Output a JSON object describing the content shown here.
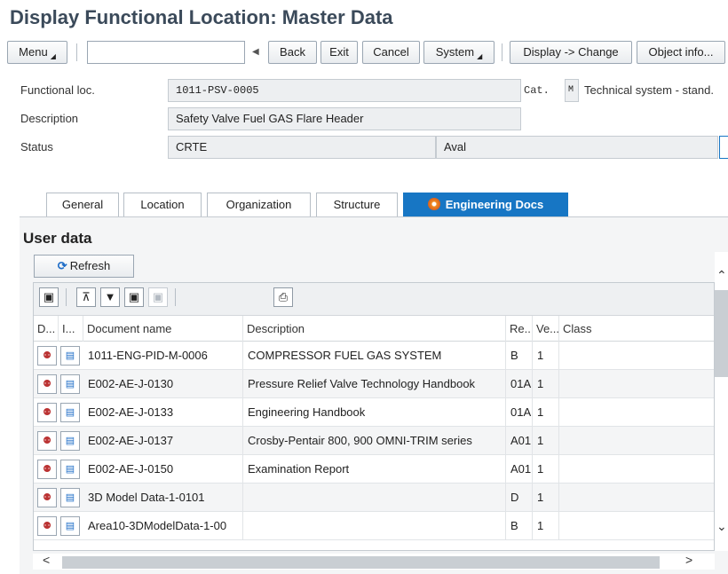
{
  "window": {
    "title": "Display Functional Location: Master Data"
  },
  "toolbar": {
    "menu": "Menu",
    "command_value": "",
    "back": "Back",
    "exit": "Exit",
    "cancel": "Cancel",
    "system": "System",
    "display_change": "Display -> Change",
    "object_info": "Object info..."
  },
  "header": {
    "functional_loc_label": "Functional loc.",
    "functional_loc_value": "1011-PSV-0005",
    "cat_label": "Cat.",
    "cat_value": "M",
    "cat_text": "Technical system - stand.",
    "description_label": "Description",
    "description_value": "Safety Valve Fuel GAS Flare Header",
    "status_label": "Status",
    "status_value": "CRTE",
    "status_value2": "Aval"
  },
  "tabs": [
    {
      "label": "General"
    },
    {
      "label": "Location"
    },
    {
      "label": "Organization"
    },
    {
      "label": "Structure"
    },
    {
      "label": "Engineering Docs",
      "active": true
    }
  ],
  "user_data": {
    "title": "User data",
    "refresh": "Refresh",
    "columns": [
      "D...",
      "I...",
      "Document name",
      "Description",
      "Re...",
      "Ve...",
      "Class"
    ],
    "rows": [
      {
        "doc": "1011-ENG-PID-M-0006",
        "desc": "COMPRESSOR FUEL GAS SYSTEM",
        "rev": "B",
        "ver": "1",
        "class": ""
      },
      {
        "doc": "E002-AE-J-0130",
        "desc": "Pressure Relief Valve Technology Handbook",
        "rev": "01A",
        "ver": "1",
        "class": ""
      },
      {
        "doc": "E002-AE-J-0133",
        "desc": "Engineering Handbook",
        "rev": "01A",
        "ver": "1",
        "class": ""
      },
      {
        "doc": "E002-AE-J-0137",
        "desc": "Crosby-Pentair 800, 900 OMNI-TRIM series",
        "rev": "A01",
        "ver": "1",
        "class": ""
      },
      {
        "doc": "E002-AE-J-0150",
        "desc": "Examination Report",
        "rev": "A01",
        "ver": "1",
        "class": ""
      },
      {
        "doc": "3D Model Data-1-0101",
        "desc": "",
        "rev": "D",
        "ver": "1",
        "class": ""
      },
      {
        "doc": "Area10-3DModelData-1-00",
        "desc": "",
        "rev": "B",
        "ver": "1",
        "class": ""
      }
    ]
  },
  "colors": {
    "accent": "#1776c4",
    "title": "#3b4a5a",
    "field_bg": "#edeff1"
  }
}
